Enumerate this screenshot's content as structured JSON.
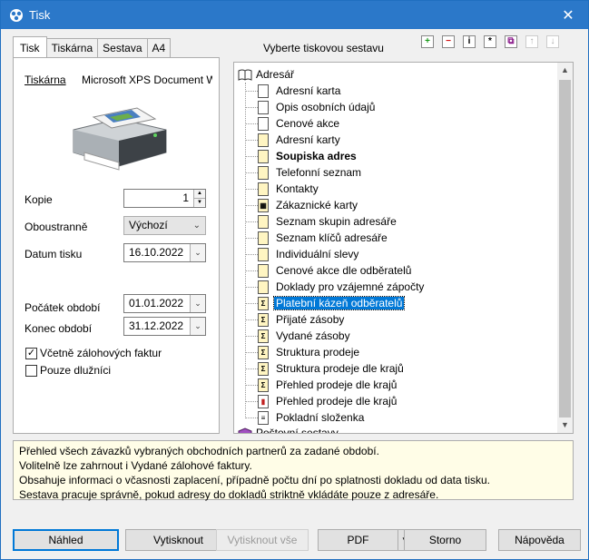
{
  "window": {
    "title": "Tisk",
    "close": "✕"
  },
  "tabs": [
    "Tisk",
    "Tiskárna",
    "Sestava",
    "A4"
  ],
  "left": {
    "printer_label": "Tiskárna",
    "printer_name": "Microsoft XPS Document W",
    "copies_label": "Kopie",
    "copies_value": "1",
    "duplex_label": "Oboustranně",
    "duplex_value": "Výchozí",
    "print_date_label": "Datum tisku",
    "print_date_value": "16.10.2022",
    "period_start_label": "Počátek období",
    "period_start_value": "01.01.2022",
    "period_end_label": "Konec období",
    "period_end_value": "31.12.2022",
    "include_advance_label": "Včetně zálohových faktur",
    "include_advance_checked": true,
    "debtors_only_label": "Pouze dlužníci",
    "debtors_only_checked": false
  },
  "tree": {
    "title": "Vyberte tiskovou sestavu",
    "root": "Adresář",
    "items": [
      {
        "label": "Adresní karta",
        "icon": "document-icon",
        "bold": false
      },
      {
        "label": "Opis osobních údajů",
        "icon": "document-icon",
        "bold": false
      },
      {
        "label": "Cenové akce",
        "icon": "document-icon",
        "bold": false
      },
      {
        "label": "Adresní karty",
        "icon": "list-document-icon",
        "bold": false
      },
      {
        "label": "Soupiska adres",
        "icon": "list-document-icon",
        "bold": true
      },
      {
        "label": "Telefonní seznam",
        "icon": "list-document-icon",
        "bold": false
      },
      {
        "label": "Kontakty",
        "icon": "list-document-icon",
        "bold": false
      },
      {
        "label": "Zákaznické karty",
        "icon": "table-document-icon",
        "bold": false
      },
      {
        "label": "Seznam skupin adresáře",
        "icon": "list-document-icon",
        "bold": false
      },
      {
        "label": "Seznam klíčů adresáře",
        "icon": "list-document-icon",
        "bold": false
      },
      {
        "label": "Individuální slevy",
        "icon": "list-document-icon",
        "bold": false
      },
      {
        "label": "Cenové akce dle odběratelů",
        "icon": "list-document-icon",
        "bold": false
      },
      {
        "label": "Doklady pro vzájemné zápočty",
        "icon": "list-document-icon",
        "bold": false
      },
      {
        "label": "Platební kázeň odběratelů",
        "icon": "sigma-icon",
        "bold": false,
        "selected": true
      },
      {
        "label": "Přijaté zásoby",
        "icon": "sigma-icon",
        "bold": false
      },
      {
        "label": "Vydané zásoby",
        "icon": "sigma-icon",
        "bold": false
      },
      {
        "label": "Struktura prodeje",
        "icon": "sigma-icon",
        "bold": false
      },
      {
        "label": "Struktura prodeje dle krajů",
        "icon": "sigma-icon",
        "bold": false
      },
      {
        "label": "Přehled prodeje dle krajů",
        "icon": "sigma-icon",
        "bold": false
      },
      {
        "label": "Přehled prodeje dle krajů",
        "icon": "chart-icon",
        "bold": false
      },
      {
        "label": "Pokladní složenka",
        "icon": "form-icon",
        "bold": false
      }
    ],
    "next_root": "Poštovní sestavy"
  },
  "description": [
    "Přehled všech závazků vybraných obchodních partnerů za zadané období.",
    "Volitelně lze zahrnout i Vydané zálohové faktury.",
    "Obsahuje informaci o včasnosti zaplacení, případně počtu dní po splatnosti dokladu od data tisku.",
    "Sestava pracuje správně, pokud adresy do dokladů striktně vkládáte pouze z adresáře."
  ],
  "buttons": {
    "preview": "Náhled",
    "print": "Vytisknout",
    "print_all": "Vytisknout vše",
    "pdf": "PDF",
    "cancel": "Storno",
    "help": "Nápověda"
  },
  "colors": {
    "accent": "#0078d7",
    "titlebar": "#2b78c9",
    "description_bg": "#fffde7"
  }
}
